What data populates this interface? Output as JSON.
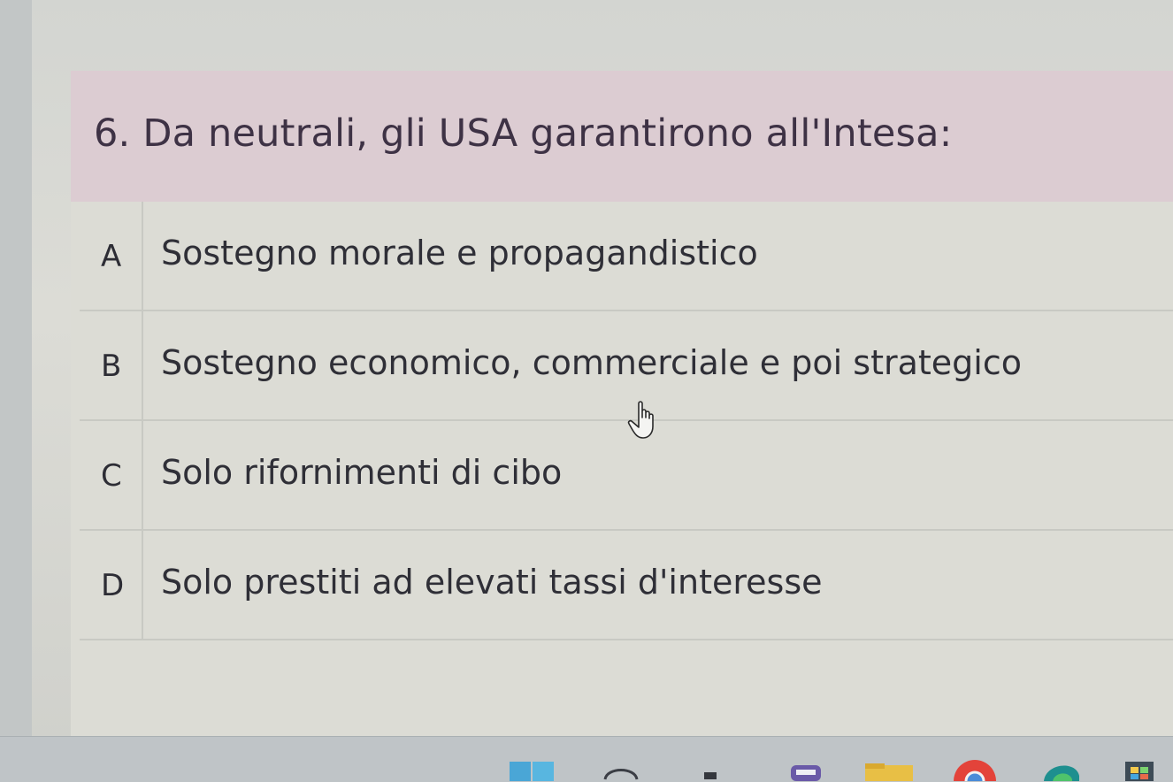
{
  "question": {
    "number": "6.",
    "text": "Da neutrali, gli USA garantirono all'Intesa:"
  },
  "answers": [
    {
      "letter": "A",
      "text": "Sostegno morale e propagandistico"
    },
    {
      "letter": "B",
      "text": "Sostegno economico, commerciale e poi strategico"
    },
    {
      "letter": "C",
      "text": "Solo rifornimenti di cibo"
    },
    {
      "letter": "D",
      "text": "Solo prestiti ad elevati tassi d'interesse"
    }
  ],
  "colors": {
    "header_background": "#dcccd2",
    "card_background": "#dcdcd5",
    "text": "#2f2f37"
  },
  "taskbar": {
    "icons": [
      "start-icon",
      "search-icon",
      "task-view-icon",
      "chat-icon",
      "file-explorer-icon",
      "chrome-icon",
      "edge-icon",
      "store-icon"
    ]
  }
}
